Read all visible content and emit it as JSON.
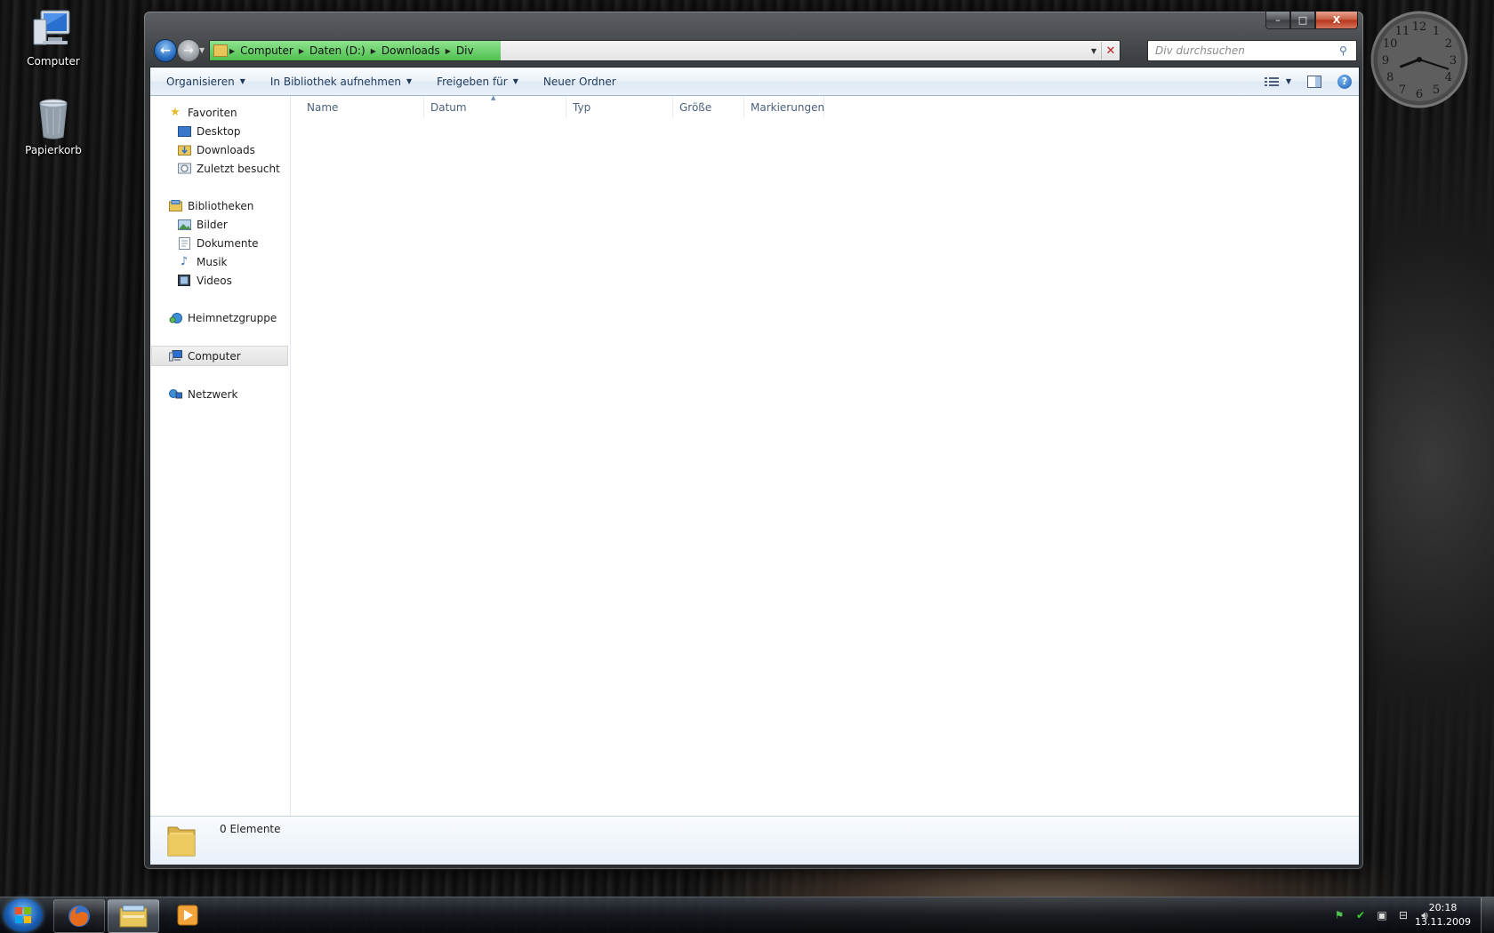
{
  "desktop": {
    "icons": [
      {
        "label": "Computer"
      },
      {
        "label": "Papierkorb"
      }
    ]
  },
  "window": {
    "caption": {
      "minimize": "–",
      "maximize": "□",
      "close": "X"
    },
    "nav": {
      "back": "←",
      "forward": "→"
    },
    "address": {
      "crumbs": [
        "Computer",
        "Daten (D:)",
        "Downloads",
        "Div"
      ],
      "progress": 0.32
    },
    "search": {
      "placeholder": "Div durchsuchen"
    },
    "toolbar": {
      "organize": "Organisieren",
      "library": "In Bibliothek aufnehmen",
      "share": "Freigeben für",
      "new_folder": "Neuer Ordner",
      "help": "?"
    },
    "navpane": {
      "favorites": "Favoriten",
      "fav_items": [
        "Desktop",
        "Downloads",
        "Zuletzt besucht"
      ],
      "libraries": "Bibliotheken",
      "lib_items": [
        "Bilder",
        "Dokumente",
        "Musik",
        "Videos"
      ],
      "homegroup": "Heimnetzgruppe",
      "computer": "Computer",
      "network": "Netzwerk"
    },
    "columns": {
      "name": "Name",
      "date": "Datum",
      "type": "Typ",
      "size": "Größe",
      "tags": "Markierungen"
    },
    "details": {
      "count": "0 Elemente"
    }
  },
  "taskbar": {
    "time": "20:18",
    "date": "13.11.2009"
  },
  "clock": {
    "hour": 8,
    "minute": 18,
    "numbers": [
      "12",
      "1",
      "2",
      "3",
      "4",
      "5",
      "6",
      "7",
      "8",
      "9",
      "10",
      "11"
    ]
  },
  "colors": {
    "accent": "#1e395b",
    "progress": "#4fc04f",
    "close": "#c75a3f"
  }
}
